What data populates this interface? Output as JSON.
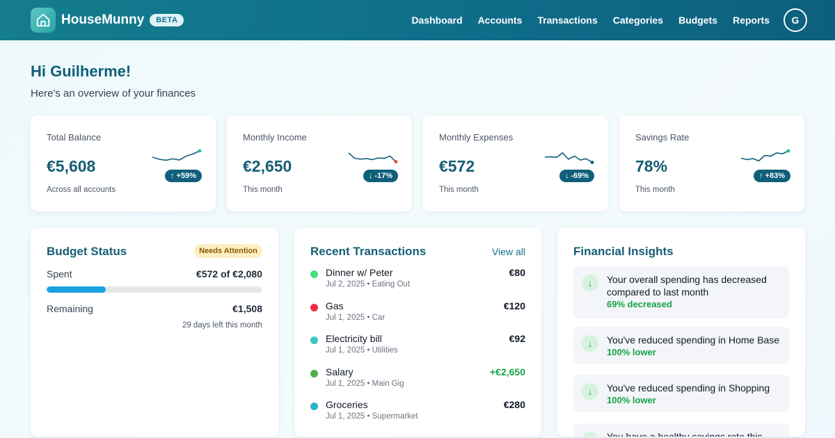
{
  "app": {
    "name": "HouseMunny",
    "badge": "BETA"
  },
  "nav": [
    "Dashboard",
    "Accounts",
    "Transactions",
    "Categories",
    "Budgets",
    "Reports"
  ],
  "user": {
    "initial": "G"
  },
  "greeting": {
    "title": "Hi Guilherme!",
    "subtitle": "Here's an overview of your finances"
  },
  "stats": [
    {
      "label": "Total Balance",
      "value": "€5,608",
      "sub": "Across all accounts",
      "change": "+59%",
      "direction": "up",
      "dot_color": "#2bb5a5",
      "trend": [
        4,
        3,
        2.5,
        3.2,
        2.6,
        4.5,
        5.5,
        7
      ]
    },
    {
      "label": "Monthly Income",
      "value": "€2,650",
      "sub": "This month",
      "change": "-17%",
      "direction": "down",
      "dot_color": "#ef4444",
      "trend": [
        6,
        3.5,
        3,
        3.3,
        2.8,
        3.6,
        3.4,
        4.5,
        1.8
      ]
    },
    {
      "label": "Monthly Expenses",
      "value": "€572",
      "sub": "This month",
      "change": "-69%",
      "direction": "down",
      "dot_color": "#0f5f7a",
      "trend": [
        4,
        4.2,
        3.9,
        6,
        3,
        4.5,
        2.6,
        3.2,
        1.5
      ]
    },
    {
      "label": "Savings Rate",
      "value": "78%",
      "sub": "This month",
      "change": "+83%",
      "direction": "up",
      "dot_color": "#2bb5a5",
      "trend": [
        3.5,
        2.8,
        3.3,
        2.2,
        4.8,
        4.5,
        6,
        5.6,
        7
      ]
    }
  ],
  "budget": {
    "title": "Budget Status",
    "badge": "Needs Attention",
    "spent_label": "Spent",
    "spent_value": "€572 of €2,080",
    "progress": 0.275,
    "remaining_label": "Remaining",
    "remaining_value": "€1,508",
    "days_left": "29 days left this month"
  },
  "transactions": {
    "title": "Recent Transactions",
    "view_all": "View all",
    "items": [
      {
        "name": "Dinner w/ Peter",
        "date": "Jul 2, 2025",
        "category": "Eating Out",
        "amount": "€80",
        "positive": false,
        "color": "#4ade80"
      },
      {
        "name": "Gas",
        "date": "Jul 1, 2025",
        "category": "Car",
        "amount": "€120",
        "positive": false,
        "color": "#ef2b46"
      },
      {
        "name": "Electricity bill",
        "date": "Jul 1, 2025",
        "category": "Utilities",
        "amount": "€92",
        "positive": false,
        "color": "#3cc8c0"
      },
      {
        "name": "Salary",
        "date": "Jul 1, 2025",
        "category": "Main Gig",
        "amount": "+€2,650",
        "positive": true,
        "color": "#4caf50"
      },
      {
        "name": "Groceries",
        "date": "Jul 1, 2025",
        "category": "Supermarket",
        "amount": "€280",
        "positive": false,
        "color": "#2bb5c8"
      }
    ]
  },
  "insights": {
    "title": "Financial Insights",
    "items": [
      {
        "text": "Your overall spending has decreased compared to last month",
        "highlight": "69% decreased",
        "icon": "arrow-down-icon"
      },
      {
        "text": "You've reduced spending in Home Base",
        "highlight": "100% lower",
        "icon": "arrow-down-icon"
      },
      {
        "text": "You've reduced spending in Shopping",
        "highlight": "100% lower",
        "icon": "arrow-down-icon"
      },
      {
        "text": "You have a healthy savings rate this",
        "highlight": "",
        "icon": "arrow-down-icon"
      }
    ]
  }
}
